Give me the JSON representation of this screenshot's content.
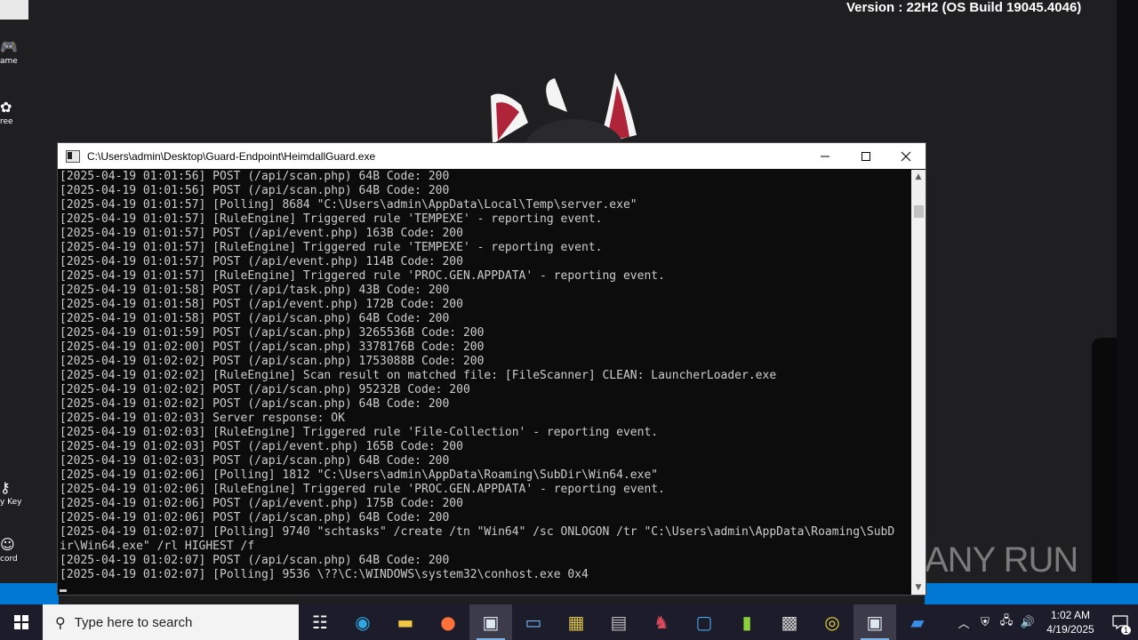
{
  "desktop": {
    "version_text": "Version : 22H2 (OS Build 19045.4046)",
    "icons": [
      {
        "label": "ame",
        "icon": "gamepad-icon"
      },
      {
        "label": "ree",
        "icon": "puzzle-icon"
      },
      {
        "label": "y Key",
        "icon": "key-icon"
      },
      {
        "label": "cord",
        "icon": "discord-icon"
      }
    ],
    "watermark": "ANY RUN"
  },
  "window": {
    "title": "C:\\Users\\admin\\Desktop\\Guard-Endpoint\\HeimdallGuard.exe",
    "controls": [
      "minimize-icon",
      "maximize-icon",
      "close-icon"
    ]
  },
  "console": {
    "lines": [
      "[2025-04-19 01:01:56] POST (/api/scan.php) 64B Code: 200",
      "[2025-04-19 01:01:56] POST (/api/scan.php) 64B Code: 200",
      "[2025-04-19 01:01:57] [Polling] 8684 \"C:\\Users\\admin\\AppData\\Local\\Temp\\server.exe\"",
      "[2025-04-19 01:01:57] [RuleEngine] Triggered rule 'TEMPEXE' - reporting event.",
      "[2025-04-19 01:01:57] POST (/api/event.php) 163B Code: 200",
      "[2025-04-19 01:01:57] [RuleEngine] Triggered rule 'TEMPEXE' - reporting event.",
      "[2025-04-19 01:01:57] POST (/api/event.php) 114B Code: 200",
      "[2025-04-19 01:01:57] [RuleEngine] Triggered rule 'PROC.GEN.APPDATA' - reporting event.",
      "[2025-04-19 01:01:58] POST (/api/task.php) 43B Code: 200",
      "[2025-04-19 01:01:58] POST (/api/event.php) 172B Code: 200",
      "[2025-04-19 01:01:58] POST (/api/scan.php) 64B Code: 200",
      "[2025-04-19 01:01:59] POST (/api/scan.php) 3265536B Code: 200",
      "[2025-04-19 01:02:00] POST (/api/scan.php) 3378176B Code: 200",
      "[2025-04-19 01:02:02] POST (/api/scan.php) 1753088B Code: 200",
      "[2025-04-19 01:02:02] [RuleEngine] Scan result on matched file: [FileScanner] CLEAN: LauncherLoader.exe",
      "[2025-04-19 01:02:02] POST (/api/scan.php) 95232B Code: 200",
      "[2025-04-19 01:02:02] POST (/api/scan.php) 64B Code: 200",
      "[2025-04-19 01:02:03] Server response: OK",
      "[2025-04-19 01:02:03] [RuleEngine] Triggered rule 'File-Collection' - reporting event.",
      "[2025-04-19 01:02:03] POST (/api/event.php) 165B Code: 200",
      "[2025-04-19 01:02:03] POST (/api/scan.php) 64B Code: 200",
      "[2025-04-19 01:02:06] [Polling] 1812 \"C:\\Users\\admin\\AppData\\Roaming\\SubDir\\Win64.exe\"",
      "[2025-04-19 01:02:06] [RuleEngine] Triggered rule 'PROC.GEN.APPDATA' - reporting event.",
      "[2025-04-19 01:02:06] POST (/api/event.php) 175B Code: 200",
      "[2025-04-19 01:02:06] POST (/api/scan.php) 64B Code: 200",
      "[2025-04-19 01:02:07] [Polling] 9740 \"schtasks\" /create /tn \"Win64\" /sc ONLOGON /tr \"C:\\Users\\admin\\AppData\\Roaming\\SubD",
      "ir\\Win64.exe\" /rl HIGHEST /f",
      "[2025-04-19 01:02:07] POST (/api/scan.php) 64B Code: 200",
      "[2025-04-19 01:02:07] [Polling] 9536 \\??\\C:\\WINDOWS\\system32\\conhost.exe 0x4"
    ]
  },
  "taskbar": {
    "search_placeholder": "Type here to search",
    "apps": [
      {
        "icon": "task-view-icon",
        "active": false
      },
      {
        "icon": "edge-icon",
        "active": false
      },
      {
        "icon": "file-explorer-icon",
        "active": false
      },
      {
        "icon": "firefox-icon",
        "active": false
      },
      {
        "icon": "console-app-icon",
        "active": true
      },
      {
        "icon": "remote-desktop-icon",
        "active": false
      },
      {
        "icon": "chip-tool-icon",
        "active": false
      },
      {
        "icon": "printer-tool-icon",
        "active": false
      },
      {
        "icon": "mascot-app-icon",
        "active": false
      },
      {
        "icon": "window-app-icon",
        "active": false
      },
      {
        "icon": "green-file-icon",
        "active": false
      },
      {
        "icon": "keyboard-tool-icon",
        "active": false
      },
      {
        "icon": "yellow-disc-icon",
        "active": false
      },
      {
        "icon": "console-app-icon",
        "active": true
      },
      {
        "icon": "office-icon",
        "active": false
      }
    ],
    "clock_time": "1:02 AM",
    "clock_date": "4/19/2025",
    "notification_count": "1"
  }
}
